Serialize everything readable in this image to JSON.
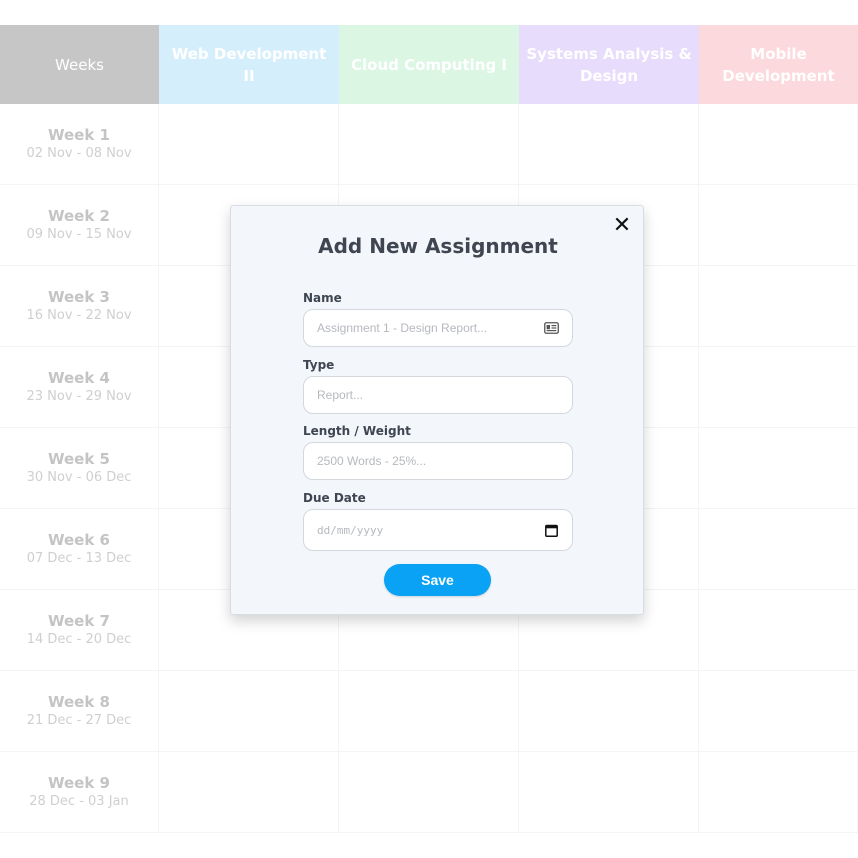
{
  "timetable": {
    "header": {
      "weeks_label": "Weeks",
      "modules": [
        {
          "label": "Web Development II",
          "color": "#d5eefc"
        },
        {
          "label": "Cloud Computing I",
          "color": "#dcf6e4"
        },
        {
          "label": "Systems Analysis & Design",
          "color": "#e7dcfb"
        },
        {
          "label": "Mobile Development",
          "color": "#fbd9dc"
        }
      ],
      "weeks_color": "#c6c6c6"
    },
    "weeks": [
      {
        "label": "Week 1",
        "dates": "02 Nov - 08 Nov"
      },
      {
        "label": "Week 2",
        "dates": "09 Nov - 15 Nov"
      },
      {
        "label": "Week 3",
        "dates": "16 Nov - 22 Nov"
      },
      {
        "label": "Week 4",
        "dates": "23 Nov - 29 Nov"
      },
      {
        "label": "Week 5",
        "dates": "30 Nov - 06 Dec"
      },
      {
        "label": "Week 6",
        "dates": "07 Dec - 13 Dec"
      },
      {
        "label": "Week 7",
        "dates": "14 Dec - 20 Dec"
      },
      {
        "label": "Week 8",
        "dates": "21 Dec - 27 Dec"
      },
      {
        "label": "Week 9",
        "dates": "28 Dec - 03 Jan"
      }
    ]
  },
  "modal": {
    "title": "Add New Assignment",
    "close_icon": "close-icon",
    "fields": {
      "name": {
        "label": "Name",
        "placeholder": "Assignment 1 - Design Report...",
        "icon": "contact-card-icon"
      },
      "type": {
        "label": "Type",
        "placeholder": "Report..."
      },
      "length": {
        "label": "Length / Weight",
        "placeholder": "2500 Words - 25%..."
      },
      "due_date": {
        "label": "Due Date",
        "placeholder": "dd/mm/yyyy",
        "icon": "calendar-icon"
      }
    },
    "save_label": "Save",
    "save_color": "#0aa2f4"
  }
}
